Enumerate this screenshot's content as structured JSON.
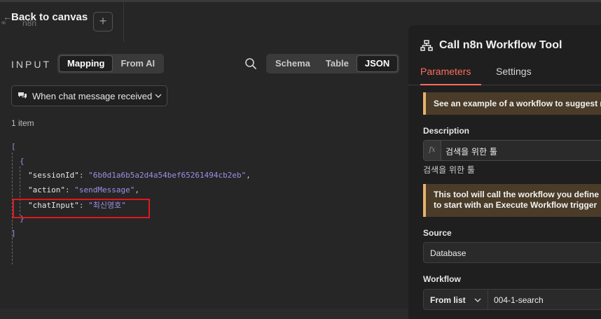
{
  "header": {
    "back_label": "Back to canvas",
    "ghost_logo_name": "n8n",
    "plus_label": "+"
  },
  "input_panel": {
    "title": "INPUT",
    "mode_options": [
      "Mapping",
      "From AI"
    ],
    "mode_selected": "Mapping",
    "view_options": [
      "Schema",
      "Table",
      "JSON"
    ],
    "view_selected": "JSON",
    "trigger_select": "When chat message received",
    "item_count": "1 item",
    "json": {
      "open_array": "[",
      "open_obj": "{",
      "close_obj": "}",
      "close_array": "]",
      "rows": [
        {
          "key": "\"sessionId\"",
          "value": "\"6b0d1a6b5a2d4a54bef65261494cb2eb\"",
          "trail": ","
        },
        {
          "key": "\"action\"",
          "value": "\"sendMessage\"",
          "trail": ","
        },
        {
          "key": "\"chatInput\"",
          "value": "\"최신영호\"",
          "trail": ""
        }
      ]
    }
  },
  "node_panel": {
    "title": "Call n8n Workflow Tool",
    "tabs": [
      "Parameters",
      "Settings"
    ],
    "active_tab": "Parameters",
    "notice_example": "See an example of a workflow to suggest m",
    "description_label": "Description",
    "description_fx": "fx",
    "description_value": "검색을 위한 툴",
    "description_preview": "검색을 위한 툴",
    "notice_tool_line1": "This tool will call the workflow you define b",
    "notice_tool_line2": "to start with an Execute Workflow trigger",
    "source_label": "Source",
    "source_value": "Database",
    "workflow_label": "Workflow",
    "workflow_mode": "From list",
    "workflow_value": "004-1-search"
  },
  "colors": {
    "accent": "#ff6d5a",
    "json_string": "#9e8fe0",
    "highlight_box": "#e0191b",
    "notice_border": "#e6b26b"
  }
}
